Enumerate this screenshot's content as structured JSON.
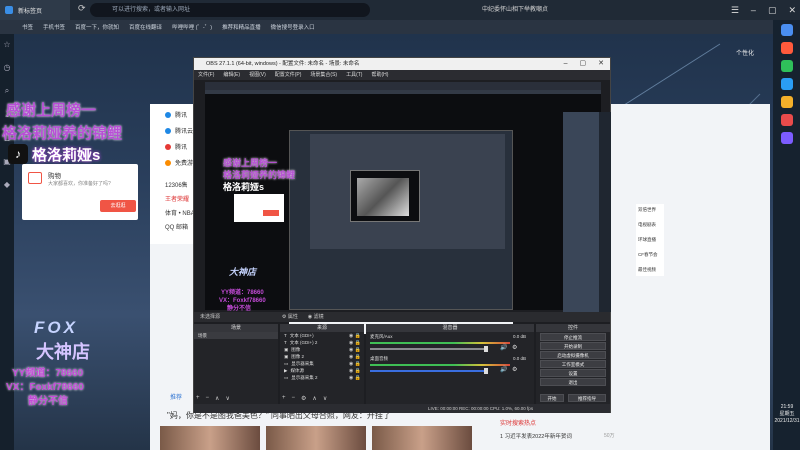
{
  "browser": {
    "tab_title": "新标签页",
    "address_placeholder": "可以进行搜索，或者输入网址",
    "search_hint": "中纪委怀山相下举教嘲贞",
    "bookmarks": [
      "书签",
      "手机书签",
      "百度一下，你就知",
      "百度在线翻译",
      "哔哩哔哩 (゜-゜)",
      "推荐和精品直播",
      "微信搜号登录入口"
    ],
    "right_text": "个性化"
  },
  "sites": [
    {
      "label": "腾讯",
      "color": "#1e88e5"
    },
    {
      "label": "腾讯云",
      "color": "#1e88e5"
    },
    {
      "label": "腾讯",
      "color": "#e53935"
    },
    {
      "label": "免费游",
      "color": "#fb8c00"
    }
  ],
  "page_texts": {
    "t12306": "12306售",
    "hot": "王者荣耀",
    "nba": "体育 • NBA",
    "qqmail": "QQ 邮箱"
  },
  "cart_popup": {
    "title": "购物",
    "subtitle": "大家都喜欢，你准备好了吗?",
    "button": "去逛逛"
  },
  "side_menu": [
    "双倍世界",
    "电视剧表",
    "环球直播",
    "CF春节会",
    "最佳视频"
  ],
  "overlay": {
    "thanks_line1": "感谢上周榜一",
    "thanks_line2": "格洛莉娅养的锦鲤",
    "streamer_name": "格洛莉娅s",
    "fox": "FOX",
    "store": "大神店",
    "yy": "YY频道：78660",
    "vx": "VX：Foxkf78660",
    "slogan": "静分不信"
  },
  "obs": {
    "title": "OBS 27.1.1 (64-bit, windows) - 配置文件: 未命名 - 场景: 未命名",
    "menu": [
      "文件(F)",
      "编辑(E)",
      "视图(V)",
      "配置文件(P)",
      "场景集合(S)",
      "工具(T)",
      "帮助(H)"
    ],
    "dock_bar": "未选择源",
    "dock_props": "属性",
    "dock_filters": "滤镜",
    "scenes_header": "场景",
    "scene_item": "场景",
    "sources_header": "来源",
    "sources": [
      "文本 (GDI+)",
      "文本 (GDI+) 2",
      "图像",
      "图像 2",
      "显示器采集",
      "媒体源",
      "显示器采集 2"
    ],
    "mixer_header": "混音器",
    "mixer_channels": [
      {
        "name": "麦克风/Aux",
        "level": "0.0 dB"
      },
      {
        "name": "桌面音频",
        "level": "0.0 dB"
      }
    ],
    "controls_header": "控件",
    "controls": [
      "停止推流",
      "开始录制",
      "启动虚拟摄像机",
      "工作室模式",
      "设置",
      "退出",
      "开始",
      "推荐指导"
    ],
    "status": "LIVE: 00:00:00   REC: 00:00:00   CPU: 1.0%, 60.00 fps",
    "preview_news": "\"妈，你是不是我亲生的\"..."
  },
  "news": {
    "tab": "推荐",
    "headline": "\"妈，你是不是图我爸美色？\" 同事晒出父母合照，网友：开挂了",
    "hot_title": "实时搜索热点",
    "hot_item": "1  习近平发表2022年新年贺词",
    "hot_count": "50万"
  },
  "clock": {
    "time": "21:59",
    "weekday": "星期五",
    "date": "2021/12/31"
  },
  "colors": {
    "obs_bg": "#1d1e22",
    "overlay_purple": "#b84fd6",
    "accent_red": "#f05545"
  }
}
